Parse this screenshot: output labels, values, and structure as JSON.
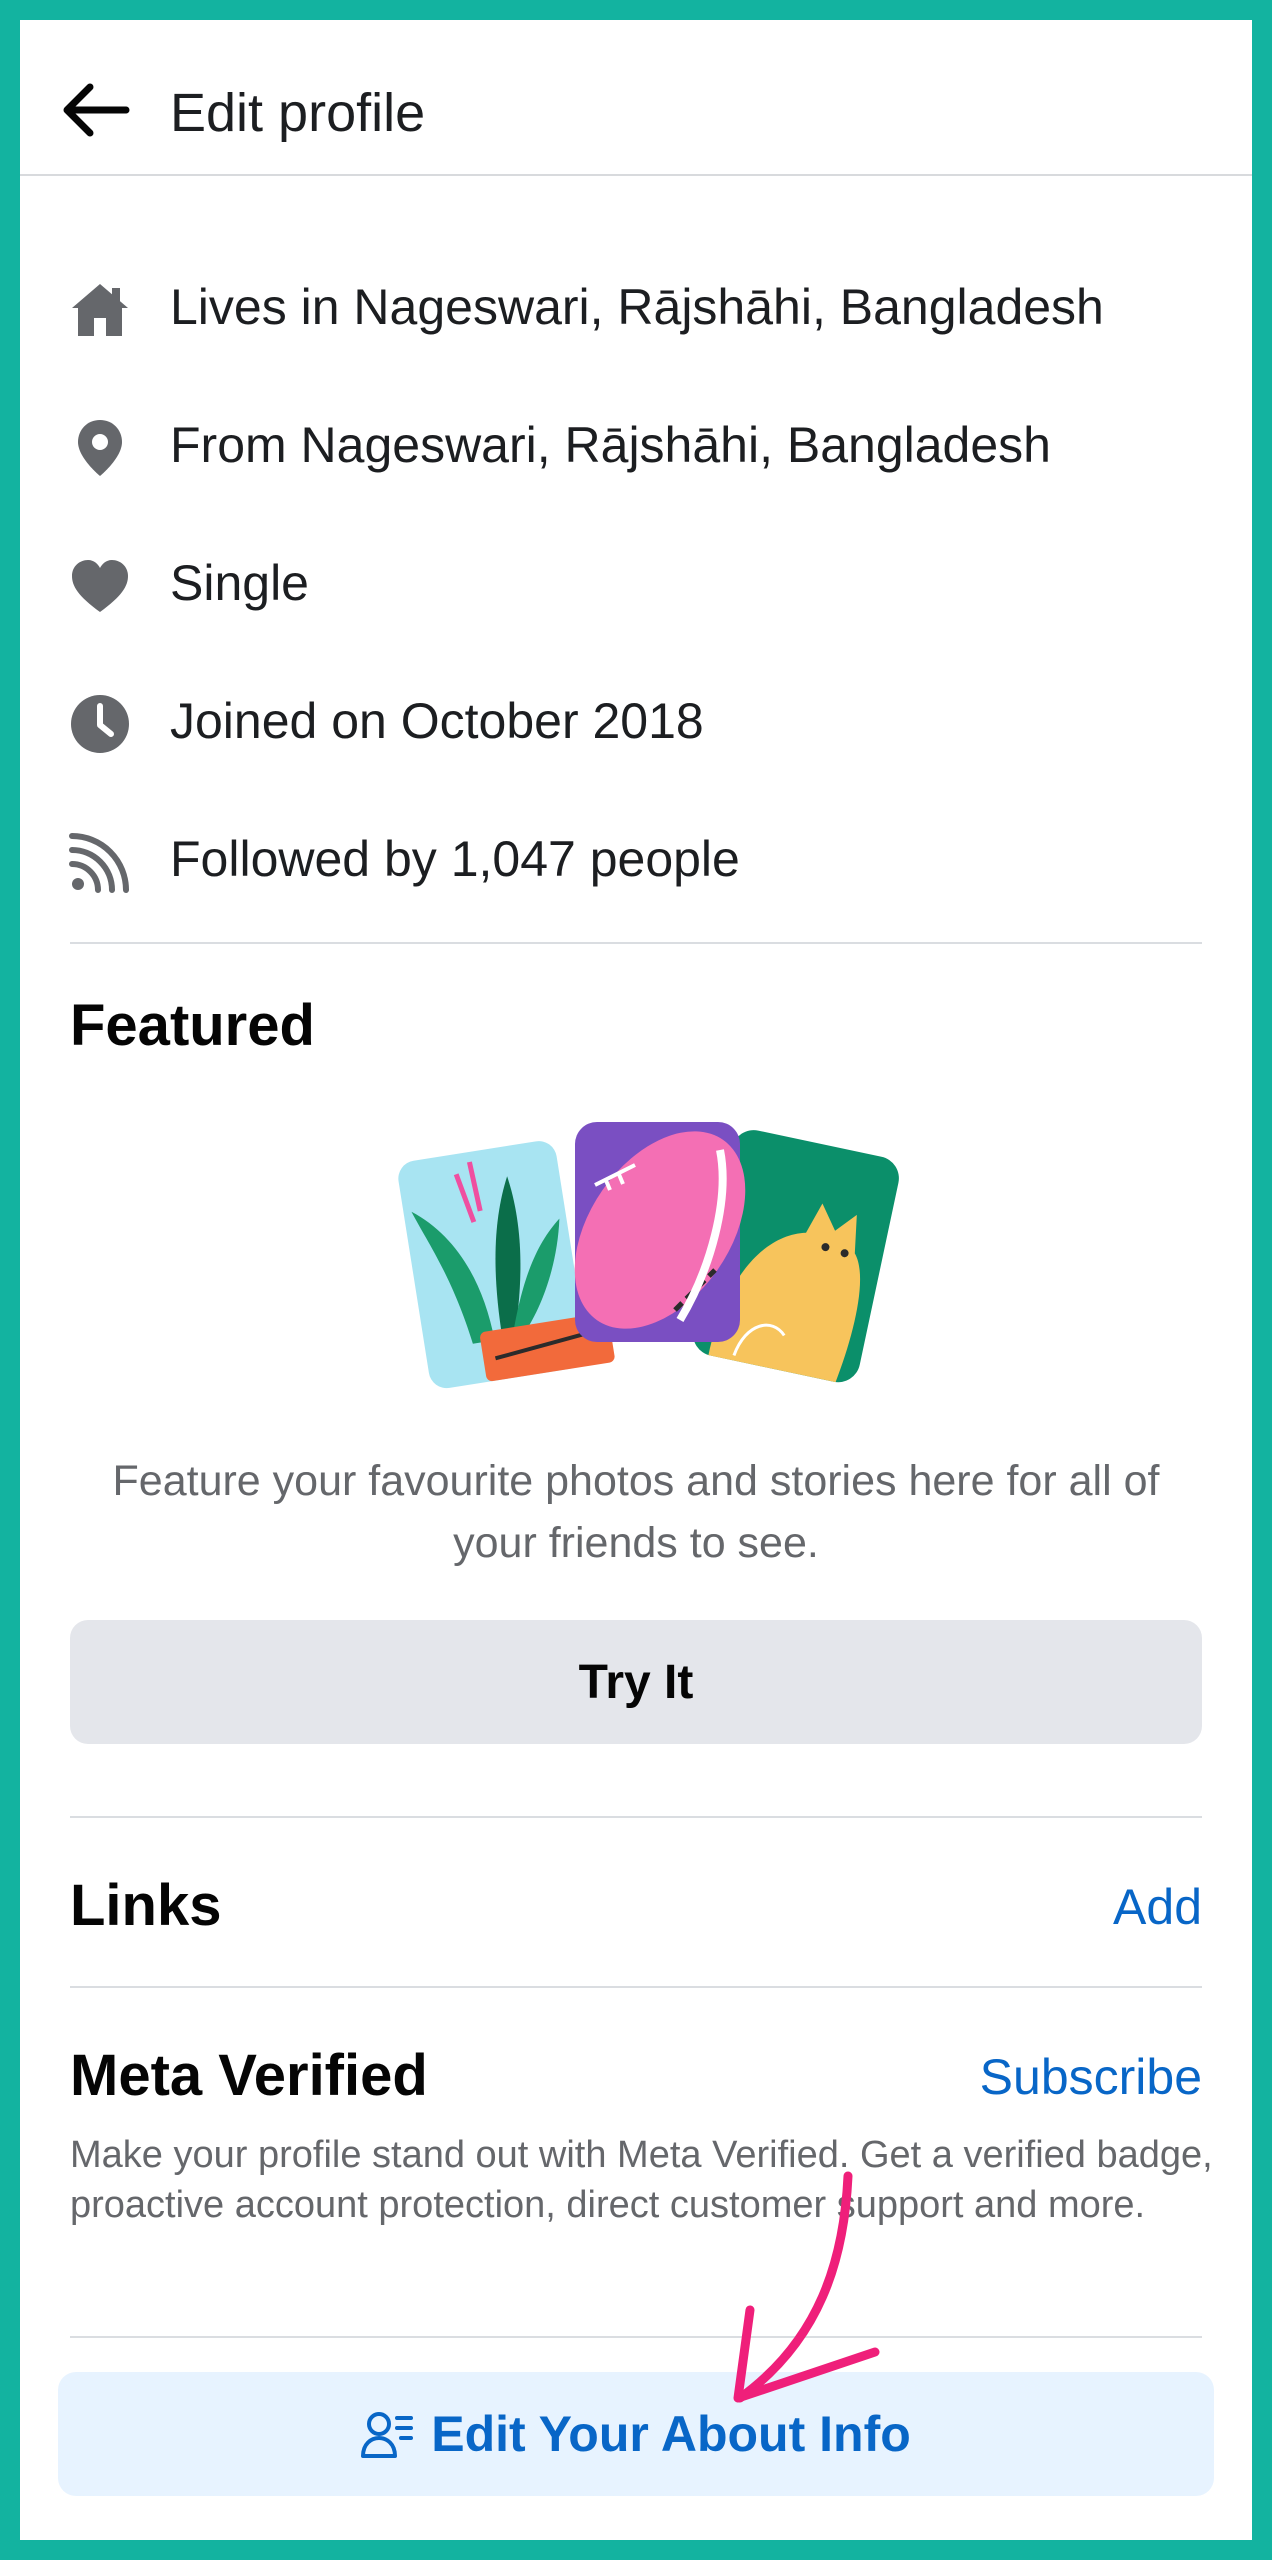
{
  "header": {
    "title": "Edit profile"
  },
  "details": [
    {
      "icon": "home-icon",
      "text": "Lives in Nageswari, Rājshāhi, Bangladesh"
    },
    {
      "icon": "location-pin-icon",
      "text": "From Nageswari, Rājshāhi, Bangladesh"
    },
    {
      "icon": "heart-icon",
      "text": "Single"
    },
    {
      "icon": "clock-icon",
      "text": "Joined on October 2018"
    },
    {
      "icon": "rss-feed-icon",
      "text": "Followed by 1,047 people"
    }
  ],
  "featured": {
    "title": "Featured",
    "description": "Feature your favourite photos and stories here for all of your friends to see.",
    "button_label": "Try It"
  },
  "links": {
    "title": "Links",
    "action_label": "Add"
  },
  "meta_verified": {
    "title": "Meta Verified",
    "action_label": "Subscribe",
    "description": "Make your profile stand out with Meta Verified. Get a verified badge, proactive account protection, direct customer support and more."
  },
  "about_button": {
    "label": "Edit Your About Info",
    "icon": "person-details-icon"
  },
  "colors": {
    "frame": "#13b3a0",
    "link_blue": "#0866c7",
    "button_gray": "#e4e6eb",
    "about_button_bg": "#e7f3ff",
    "annotation_arrow": "#ef1f7a"
  }
}
